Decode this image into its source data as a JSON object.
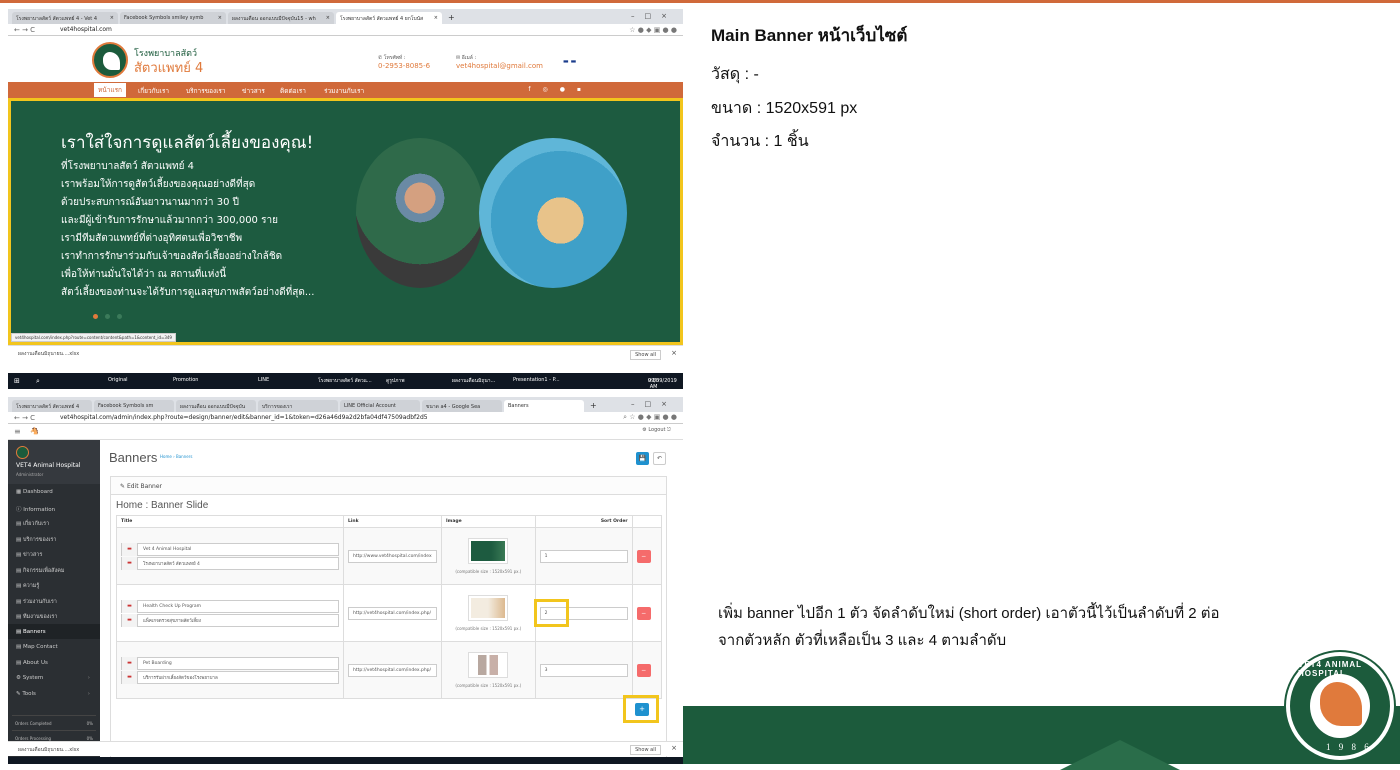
{
  "notes": {
    "title": "Main Banner หน้าเว็บไซต์",
    "material": "วัสดุ : -",
    "size": "ขนาด : 1520x591 px",
    "quantity": "จำนวน : 1 ชิ้น",
    "instruction_line1": "เพิ่ม banner ไปอีก 1 ตัว จัดลำดับใหม่ (short order) เอาตัวนี้ไว้เป็นลำดับที่ 2 ต่อ",
    "instruction_line2": "จากตัวหลัก ตัวที่เหลือเป็น 3 และ 4 ตามลำดับ"
  },
  "logo": {
    "ring_text": "VET4 ANIMAL HOSPITAL",
    "year": "1 9 8 6"
  },
  "shot1": {
    "tabs": [
      "โรงพยาบาลสัตว์ สัตวแพทย์ 4 - Vet 4",
      "Facebook Symbols smiley symb",
      "ผลงานเดือน ออกแบบมีปัจจุบัน15 - wh",
      "โรงพยาบาลสัตว์ สัตวแพทย์ 4 ยกโบนัส"
    ],
    "url": "vet4hospital.com",
    "site_name_line1": "โรงพยาบาลสัตว์",
    "site_name_line2": "สัตวแพทย์ 4",
    "phone_label": "โทรศัพท์ :",
    "phone": "0-2953-8085-6",
    "email_label": "อีเมล์ :",
    "email": "vet4hospital@gmail.com",
    "nav": [
      "หน้าแรก",
      "เกี่ยวกับเรา",
      "บริการของเรา",
      "ข่าวสาร",
      "ติดต่อเรา",
      "ร่วมงานกับเรา"
    ],
    "banner_heading": "เราใส่ใจการดูแลสัตว์เลี้ยงของคุณ!",
    "banner_lines": [
      "ที่โรงพยาบาลสัตว์ สัตวแพทย์ 4",
      "เราพร้อมให้การดูสัตว์เลี้ยงของคุณอย่างดีที่สุด",
      "ด้วยประสบการณ์อันยาวนานมากว่า 30 ปี",
      "และมีผู้เข้ารับการรักษาแล้วมากกว่า 300,000 ราย",
      "เรามีทีมสัตวแพทย์ที่ต่างอุทิศตนเพื่อวิชาชีพ",
      "เราทำการรักษาร่วมกับเจ้าของสัตว์เลี้ยงอย่างใกล้ชิด",
      "เพื่อให้ท่านมั่นใจได้ว่า ณ สถานที่แห่งนี้",
      "สัตว์เลี้ยงของท่านจะได้รับการดูแลสุขภาพสัตว์อย่างดีที่สุด..."
    ],
    "status_url": "vet4hospital.com/index.php?route=content/content&path=1&content_id=349",
    "download_file": "ผลงานเดือนมิถุนายน....xlsx",
    "show_all": "Show all",
    "taskbar_items": [
      "Original",
      "Promotion",
      "LINE",
      "โรงพยาบาลสัตว์ สัตวแ...",
      "ดูรูปภาพ",
      "ผลงานเดือนมิถุนา...",
      "Presentation1 - P..."
    ],
    "clock_time": "9:55 AM",
    "clock_date": "09/09/2019"
  },
  "shot2": {
    "tabs": [
      "โรงพยาบาลสัตว์ สัตวแพทย์ 4",
      "Facebook Symbols sm",
      "ผลงานเดือน ออกแบบมีปัจจุบัน",
      "บริการของเรา",
      "LINE Official Account",
      "ขนาด a4 - Google Sea",
      "Banners"
    ],
    "url": "vet4hospital.com/admin/index.php?route=design/banner/edit&banner_id=1&token=d26a46d9a2d2bfa04df47509adbf2d5",
    "logout": "Logout",
    "brand": "VET4 Animal Hospital",
    "role": "Administrator",
    "sidebar": [
      {
        "icon": "▦",
        "label": "Dashboard",
        "arrow": ""
      },
      {
        "icon": "ⓘ",
        "label": "Information",
        "arrow": ""
      },
      {
        "icon": "▤",
        "label": "เกี่ยวกับเรา",
        "arrow": ""
      },
      {
        "icon": "▤",
        "label": "บริการของเรา",
        "arrow": ""
      },
      {
        "icon": "▤",
        "label": "ข่าวสาร",
        "arrow": ""
      },
      {
        "icon": "▤",
        "label": "กิจกรรมเพื่อสังคม",
        "arrow": ""
      },
      {
        "icon": "▤",
        "label": "ความรู้",
        "arrow": ""
      },
      {
        "icon": "▤",
        "label": "ร่วมงานกับเรา",
        "arrow": ""
      },
      {
        "icon": "▤",
        "label": "ทีมงานของเรา",
        "arrow": ""
      },
      {
        "icon": "▤",
        "label": "Banners",
        "arrow": ""
      },
      {
        "icon": "▤",
        "label": "Map Contact",
        "arrow": ""
      },
      {
        "icon": "▤",
        "label": "About Us",
        "arrow": ""
      },
      {
        "icon": "⚙",
        "label": "System",
        "arrow": "›"
      },
      {
        "icon": "✎",
        "label": "Tools",
        "arrow": "›"
      }
    ],
    "stats": [
      {
        "label": "Orders Completed",
        "value": "0%"
      },
      {
        "label": "Orders Processing",
        "value": "0%"
      }
    ],
    "page_title": "Banners",
    "breadcrumb": "Home › Banners",
    "panel_heading": "Edit Banner",
    "group_title": "Home : Banner Slide",
    "columns": [
      "Title",
      "Link",
      "Image",
      "Sort Order"
    ],
    "rows": [
      {
        "en": "Vet 4 Animal Hospital",
        "th": "โรงพยาบาลสัตว์ สัตวแพทย์ 4",
        "link": "http://www.vet4hospital.com/index",
        "compat": "(compatible size : 1520x591 px.)",
        "sort": "1"
      },
      {
        "en": "Health Check Up Program",
        "th": "แพ็คเกจตรวจสุขภาพสัตว์เลี้ยง",
        "link": "http://vet4hospital.com/index.php/",
        "compat": "(compatible size : 1520x591 px.)",
        "sort": "2"
      },
      {
        "en": "Pet Boarding",
        "th": "บริการรับฝากเลี้ยงสัตว์ของโรงพยาบาล",
        "link": "http://vet4hospital.com/index.php/",
        "compat": "(compatible size : 1520x591 px.)",
        "sort": "3"
      }
    ],
    "download_file": "ผลงานเดือนมิถุนายน....xlsx",
    "show_all": "Show all"
  },
  "colors": {
    "brand_green": "#1c5b3c",
    "brand_orange": "#d0693a",
    "highlight": "#f2c51d",
    "admin_blue": "#1e91cf"
  }
}
